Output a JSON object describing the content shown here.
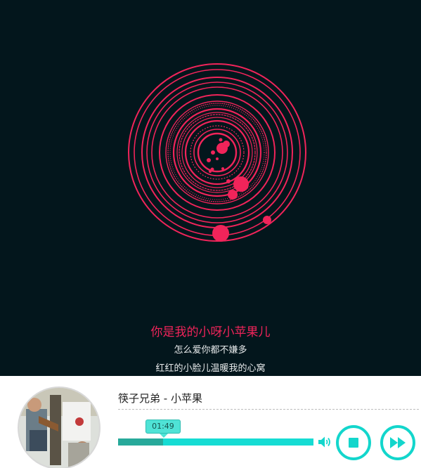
{
  "lyrics": {
    "active": "你是我的小呀小苹果儿",
    "next_1": "怎么爱你都不嫌多",
    "next_2": "红红的小脸儿温暖我的心窝"
  },
  "player": {
    "song_title": "筷子兄弟 - 小苹果",
    "current_time": "01:49",
    "progress_fraction": 0.23,
    "icons": {
      "volume": "volume-icon",
      "stop": "stop-icon",
      "next": "fast-forward-icon"
    }
  },
  "colors": {
    "visual_accent": "#f0245a",
    "background": "#03161c",
    "player_accent": "#13d6cc",
    "progress_played": "#27a99a"
  }
}
